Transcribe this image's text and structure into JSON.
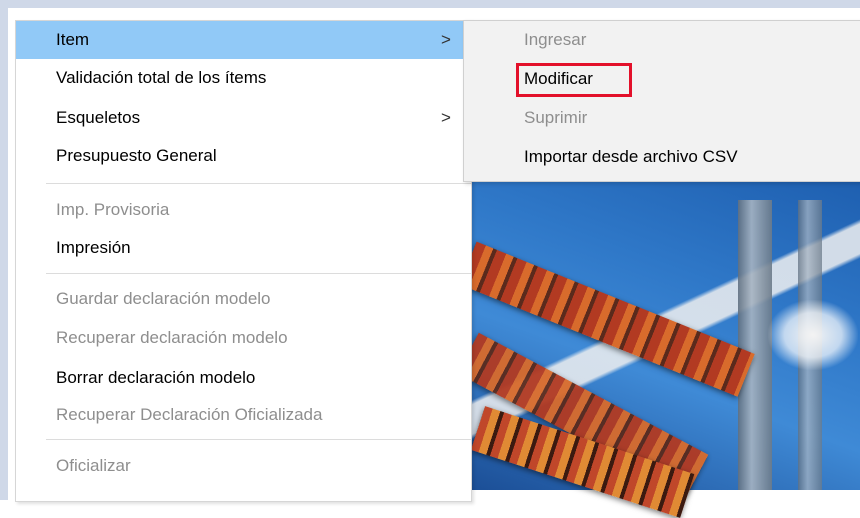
{
  "main_menu": {
    "items": [
      {
        "label": "Item",
        "state": "selected",
        "submenu": true
      },
      {
        "label": "Validación total de los ítems",
        "state": "enabled"
      },
      {
        "label": "Esqueletos",
        "state": "enabled",
        "submenu": true
      },
      {
        "label": "Presupuesto General",
        "state": "enabled"
      },
      {
        "label": "Imp. Provisoria",
        "state": "disabled"
      },
      {
        "label": "Impresión",
        "state": "enabled"
      },
      {
        "label": "Guardar declaración modelo",
        "state": "disabled"
      },
      {
        "label": "Recuperar declaración modelo",
        "state": "disabled"
      },
      {
        "label": "Borrar declaración modelo",
        "state": "enabled"
      },
      {
        "label": "Recuperar Declaración Oficializada",
        "state": "disabled"
      },
      {
        "label": "Oficializar",
        "state": "disabled"
      }
    ],
    "submenu_arrow": ">"
  },
  "sub_menu": {
    "items": [
      {
        "label": "Ingresar",
        "state": "disabled"
      },
      {
        "label": "Modificar",
        "state": "enabled",
        "highlighted": true
      },
      {
        "label": "Suprimir",
        "state": "disabled"
      },
      {
        "label": "Importar desde archivo CSV",
        "state": "enabled"
      }
    ]
  },
  "colors": {
    "selected_item_bg": "#91c9f7",
    "disabled_text": "#8e8e8e",
    "highlight_box": "#e3102a",
    "submenu_bg": "#f2f2f2"
  }
}
